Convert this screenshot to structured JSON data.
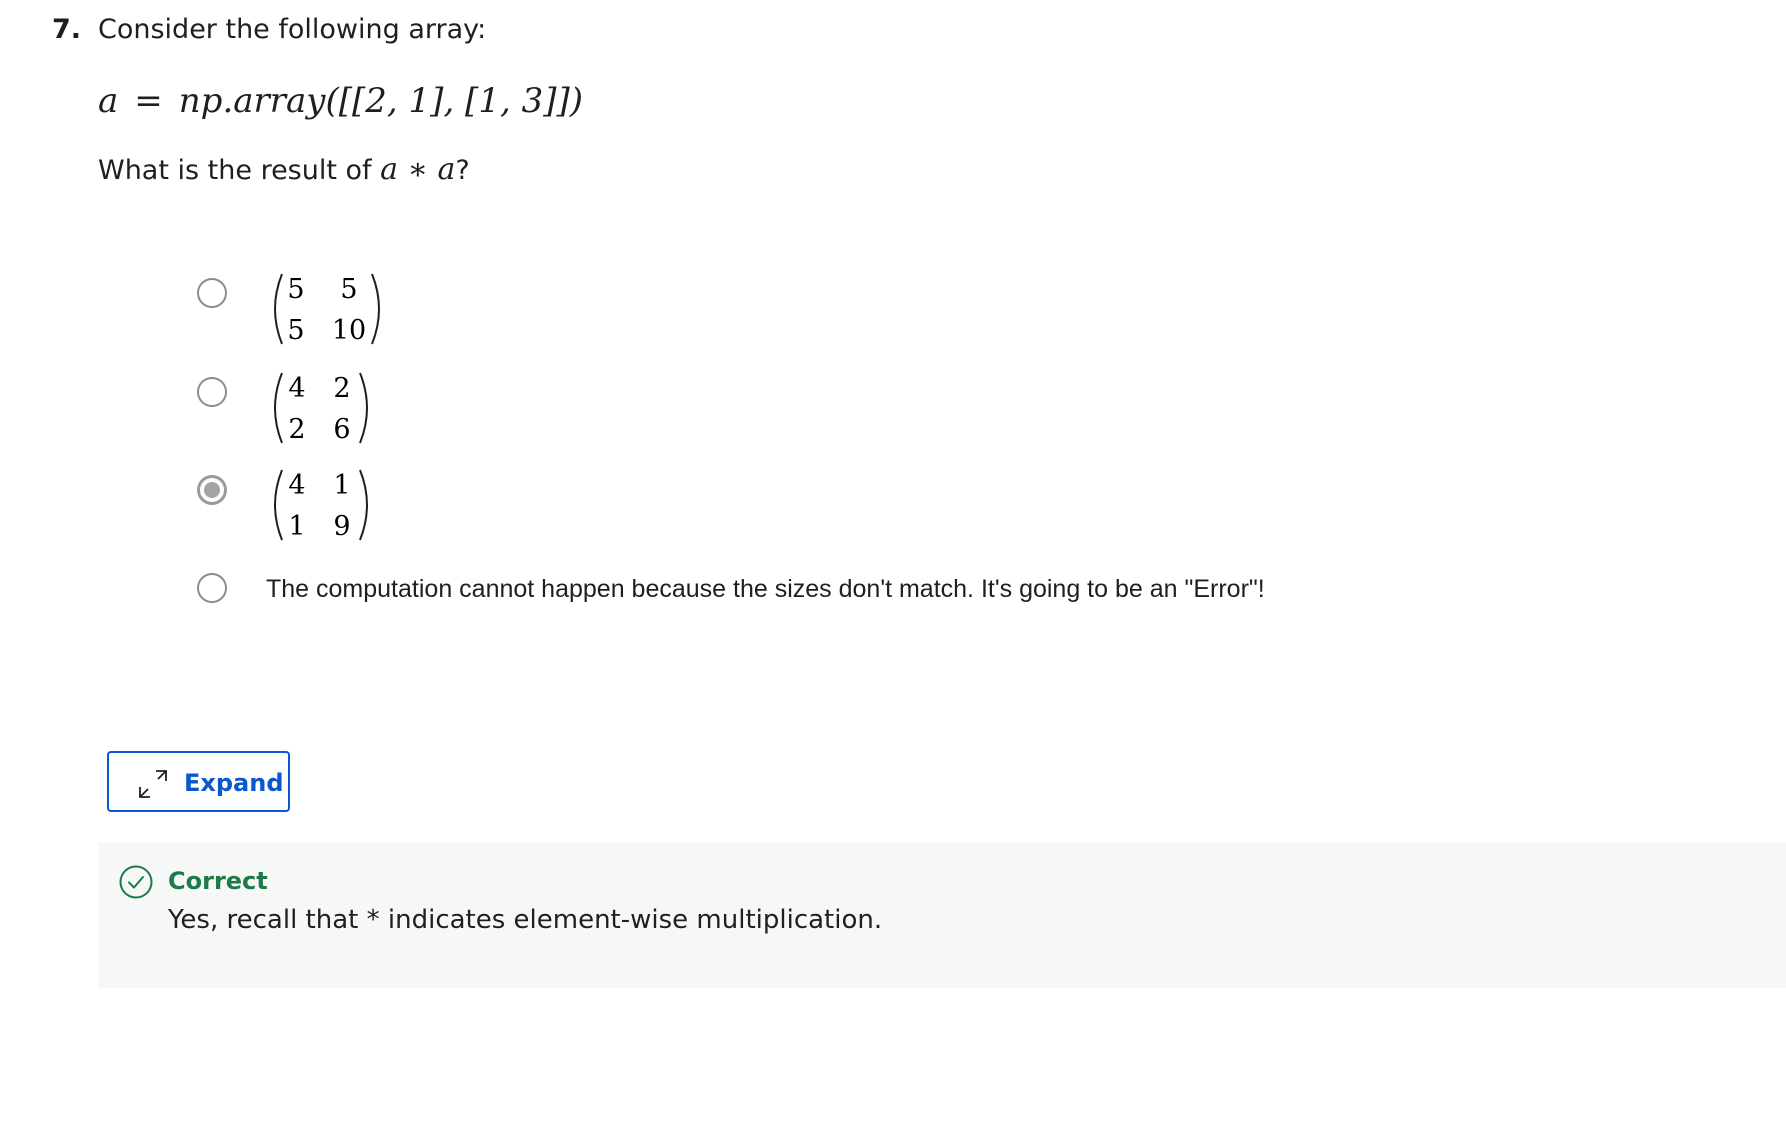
{
  "question": {
    "number": "7.",
    "text": "Consider the following array:",
    "equation": {
      "lhs": "a",
      "equals": "=",
      "rhs": "np.array([[2, 1], [1, 3]])"
    },
    "prompt": {
      "before": "What is the result of ",
      "math": "a ∗ a",
      "after": "?"
    }
  },
  "options": [
    {
      "id": "opt1",
      "type": "matrix",
      "rows": [
        [
          "5",
          "5"
        ],
        [
          "5",
          "10"
        ]
      ],
      "selected": false
    },
    {
      "id": "opt2",
      "type": "matrix",
      "rows": [
        [
          "4",
          "2"
        ],
        [
          "2",
          "6"
        ]
      ],
      "selected": false
    },
    {
      "id": "opt3",
      "type": "matrix",
      "rows": [
        [
          "4",
          "1"
        ],
        [
          "1",
          "9"
        ]
      ],
      "selected": true
    },
    {
      "id": "opt4",
      "type": "text",
      "text": "The computation cannot happen because the sizes don't match. It's going to be an \"Error\"!",
      "selected": false
    }
  ],
  "expand_button": {
    "label": "Expand",
    "icon": "expand-arrows-icon"
  },
  "feedback": {
    "status": "Correct",
    "message": "Yes, recall that * indicates element-wise multiplication.",
    "icon": "check-circle-icon",
    "status_color": "#1e7a48",
    "background_color": "#f6f8f7"
  },
  "colors": {
    "accent": "#0b57d0",
    "text": "#1f1f1f",
    "radio_border": "#8c8c8c",
    "radio_selected_fill": "#a3a3a3"
  }
}
